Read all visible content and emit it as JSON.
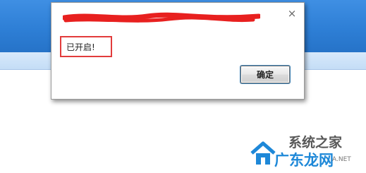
{
  "dialog": {
    "message": "已开启!",
    "ok_label": "确定",
    "close_glyph": "×"
  },
  "watermark": {
    "line1": "系统之家",
    "line2": "广东龙网",
    "url_fragment": "A.NET"
  },
  "colors": {
    "header_blue": "#2e7fd6",
    "subbar_blue": "#c4ddf6",
    "highlight_red": "#e23c3c",
    "redaction_red": "#e8201f"
  }
}
